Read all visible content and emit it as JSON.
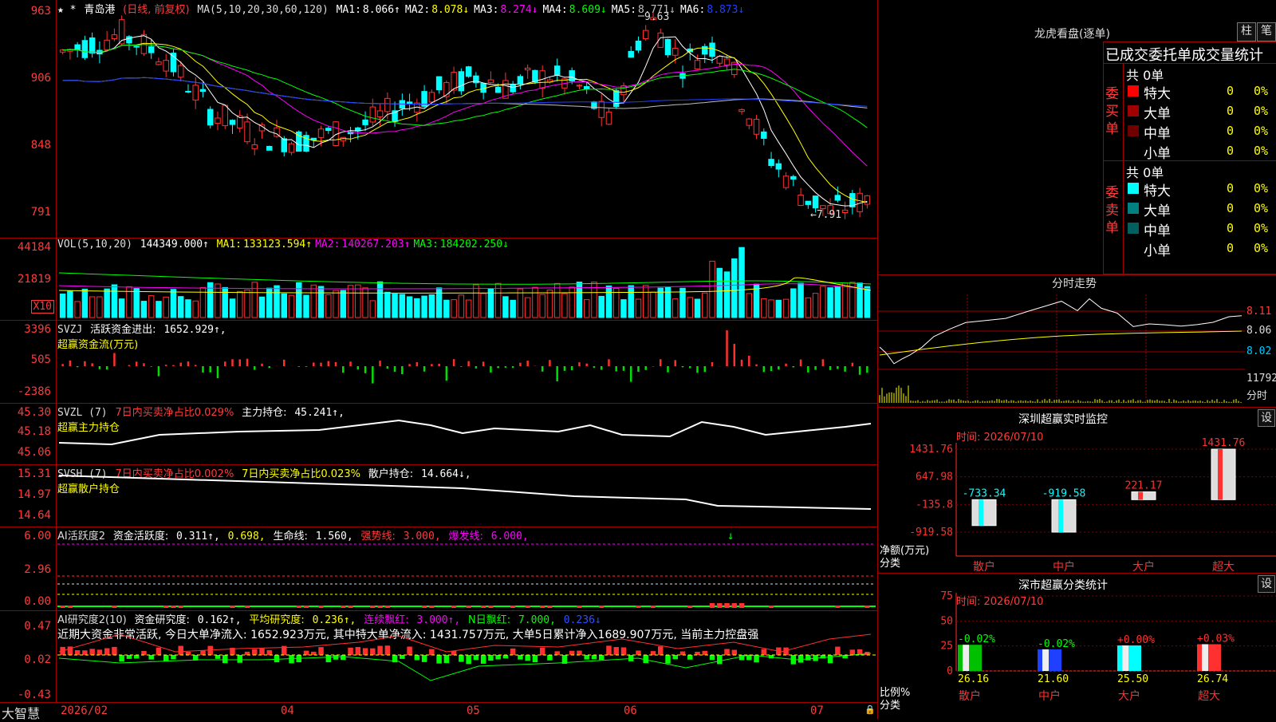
{
  "main": {
    "star": "★ *",
    "stock_name": "青岛港",
    "period_label": "(日线, 前复权)",
    "ma_header": "MA(5,10,20,30,60,120)",
    "ma_values": [
      {
        "label": "MA1:",
        "value": "8.066↑",
        "color": "#ffffff"
      },
      {
        "label": "MA2:",
        "value": "8.078↓",
        "color": "#ffff00"
      },
      {
        "label": "MA3:",
        "value": "8.274↓",
        "color": "#ff00ff"
      },
      {
        "label": "MA4:",
        "value": "8.609↓",
        "color": "#00ff00"
      },
      {
        "label": "MA5:",
        "value": "8.771↓",
        "color": "#c0c0c0"
      },
      {
        "label": "MA6:",
        "value": "8.873↓",
        "color": "#2040ff"
      }
    ],
    "y_ticks": [
      "963",
      "906",
      "848",
      "791"
    ],
    "high_label": "9.63",
    "low_label": "←7.91"
  },
  "vol": {
    "header": "VOL(5,10,20)",
    "value": "144349.000↑",
    "mas": [
      {
        "label": "MA1:",
        "value": "133123.594↑",
        "color": "#ffff00"
      },
      {
        "label": "MA2:",
        "value": "140267.203↑",
        "color": "#ff00ff"
      },
      {
        "label": "MA3:",
        "value": "184202.250↓",
        "color": "#00ff00"
      }
    ],
    "y_ticks": [
      "44184",
      "21819"
    ],
    "unit": "X10"
  },
  "svzj": {
    "header": "SVZJ",
    "label": "活跃资金进出:",
    "value": "1652.929↑,",
    "subtitle": "超赢资金流(万元)",
    "y_ticks": [
      "3396",
      "505",
      "-2386"
    ]
  },
  "svzl": {
    "header": "SVZL (7)",
    "label1": "7日内买卖净占比0.029%",
    "label2": "主力持仓:",
    "value": "45.241↑,",
    "subtitle": "超赢主力持仓",
    "y_ticks": [
      "45.30",
      "45.18",
      "45.06"
    ]
  },
  "svsh": {
    "header": "SVSH (7)",
    "label1": "7日内买卖净占比0.002%",
    "label2": "7日内买卖净占比0.023%",
    "label3": "散户持仓:",
    "value": "14.664↓,",
    "subtitle": "超赢散户持仓",
    "y_ticks": [
      "15.31",
      "14.97",
      "14.64"
    ]
  },
  "ai1": {
    "header": "AI活跃度2",
    "l1": "资金活跃度:",
    "v1": "0.311↑,",
    "v2": "0.698,",
    "l3": "生命线:",
    "v3": "1.560,",
    "l4": "强势线:",
    "v4": "3.000,",
    "l5": "爆发线:",
    "v5": "6.000,",
    "y_ticks": [
      "6.00",
      "2.96",
      "0.00"
    ]
  },
  "ai2": {
    "header": "AI研究度2(10)",
    "l1": "资金研究度:",
    "v1": "0.162↑,",
    "l2": "平均研究度:",
    "v2": "0.236↑,",
    "l3": "连续飘红:",
    "v3": "3.000↑,",
    "l4": "N日飘红:",
    "v4": "7.000,",
    "v5": "0.236↓",
    "text": "近期大资金非常活跃, 今日大单净流入: 1652.923万元, 其中特大单净流入: 1431.757万元, 大单5日累计净入1689.907万元, 当前主力控盘强",
    "y_ticks": [
      "0.47",
      "0.02",
      "-0.43"
    ]
  },
  "xaxis": {
    "brand": "大智慧",
    "labels": [
      "2026/02",
      "04",
      "05",
      "06",
      "07"
    ]
  },
  "dragon": {
    "title": "龙虎看盘(逐单)",
    "btn1": "柱",
    "btn2": "笔",
    "subtitle": "已成交委托单成交量统计",
    "buy_label": "委买单",
    "sell_label": "委卖单",
    "buy_total": "共 0单",
    "sell_total": "共 0单",
    "buy_rows": [
      {
        "name": "特大",
        "count": "0",
        "pct": "0%",
        "color": "#ff0000"
      },
      {
        "name": "大单",
        "count": "0",
        "pct": "0%",
        "color": "#a00000"
      },
      {
        "name": "中单",
        "count": "0",
        "pct": "0%",
        "color": "#700000"
      },
      {
        "name": "小单",
        "count": "0",
        "pct": "0%",
        "color": ""
      }
    ],
    "sell_rows": [
      {
        "name": "特大",
        "count": "0",
        "pct": "0%",
        "color": "#00ffff"
      },
      {
        "name": "大单",
        "count": "0",
        "pct": "0%",
        "color": "#008080"
      },
      {
        "name": "中单",
        "count": "0",
        "pct": "0%",
        "color": "#006060"
      },
      {
        "name": "小单",
        "count": "0",
        "pct": "0%",
        "color": ""
      }
    ]
  },
  "intraday": {
    "title": "分时走势",
    "y_ticks": [
      "8.11",
      "8.06",
      "8.02"
    ],
    "vol_label": "11792",
    "bottom_label": "分时"
  },
  "sz_monitor": {
    "title": "深圳超赢实时监控",
    "btn": "设",
    "time": "时间: 2026/07/10",
    "y_ticks": [
      "1431.76",
      "647.98",
      "-135.8",
      "-919.58"
    ],
    "axis_label1": "净额(万元)",
    "axis_label2": "分类",
    "categories": [
      "散户",
      "中户",
      "大户",
      "超大"
    ],
    "values": [
      -733.34,
      -919.58,
      221.17,
      1431.76
    ],
    "value_labels": [
      "-733.34",
      "-919.58",
      "221.17",
      "1431.76"
    ]
  },
  "sz_stats": {
    "title": "深市超赢分类统计",
    "btn": "设",
    "time": "时间: 2026/07/10",
    "y_ticks": [
      "75",
      "50",
      "25",
      "0"
    ],
    "axis_label1": "比例%",
    "axis_label2": "分类",
    "categories": [
      "散户",
      "中户",
      "大户",
      "超大"
    ],
    "values": [
      26.16,
      21.6,
      25.5,
      26.74
    ],
    "value_labels": [
      "26.16",
      "21.60",
      "25.50",
      "26.74"
    ],
    "changes": [
      "-0.02%",
      "-0.02%",
      "+0.00%",
      "+0.03%"
    ]
  }
}
